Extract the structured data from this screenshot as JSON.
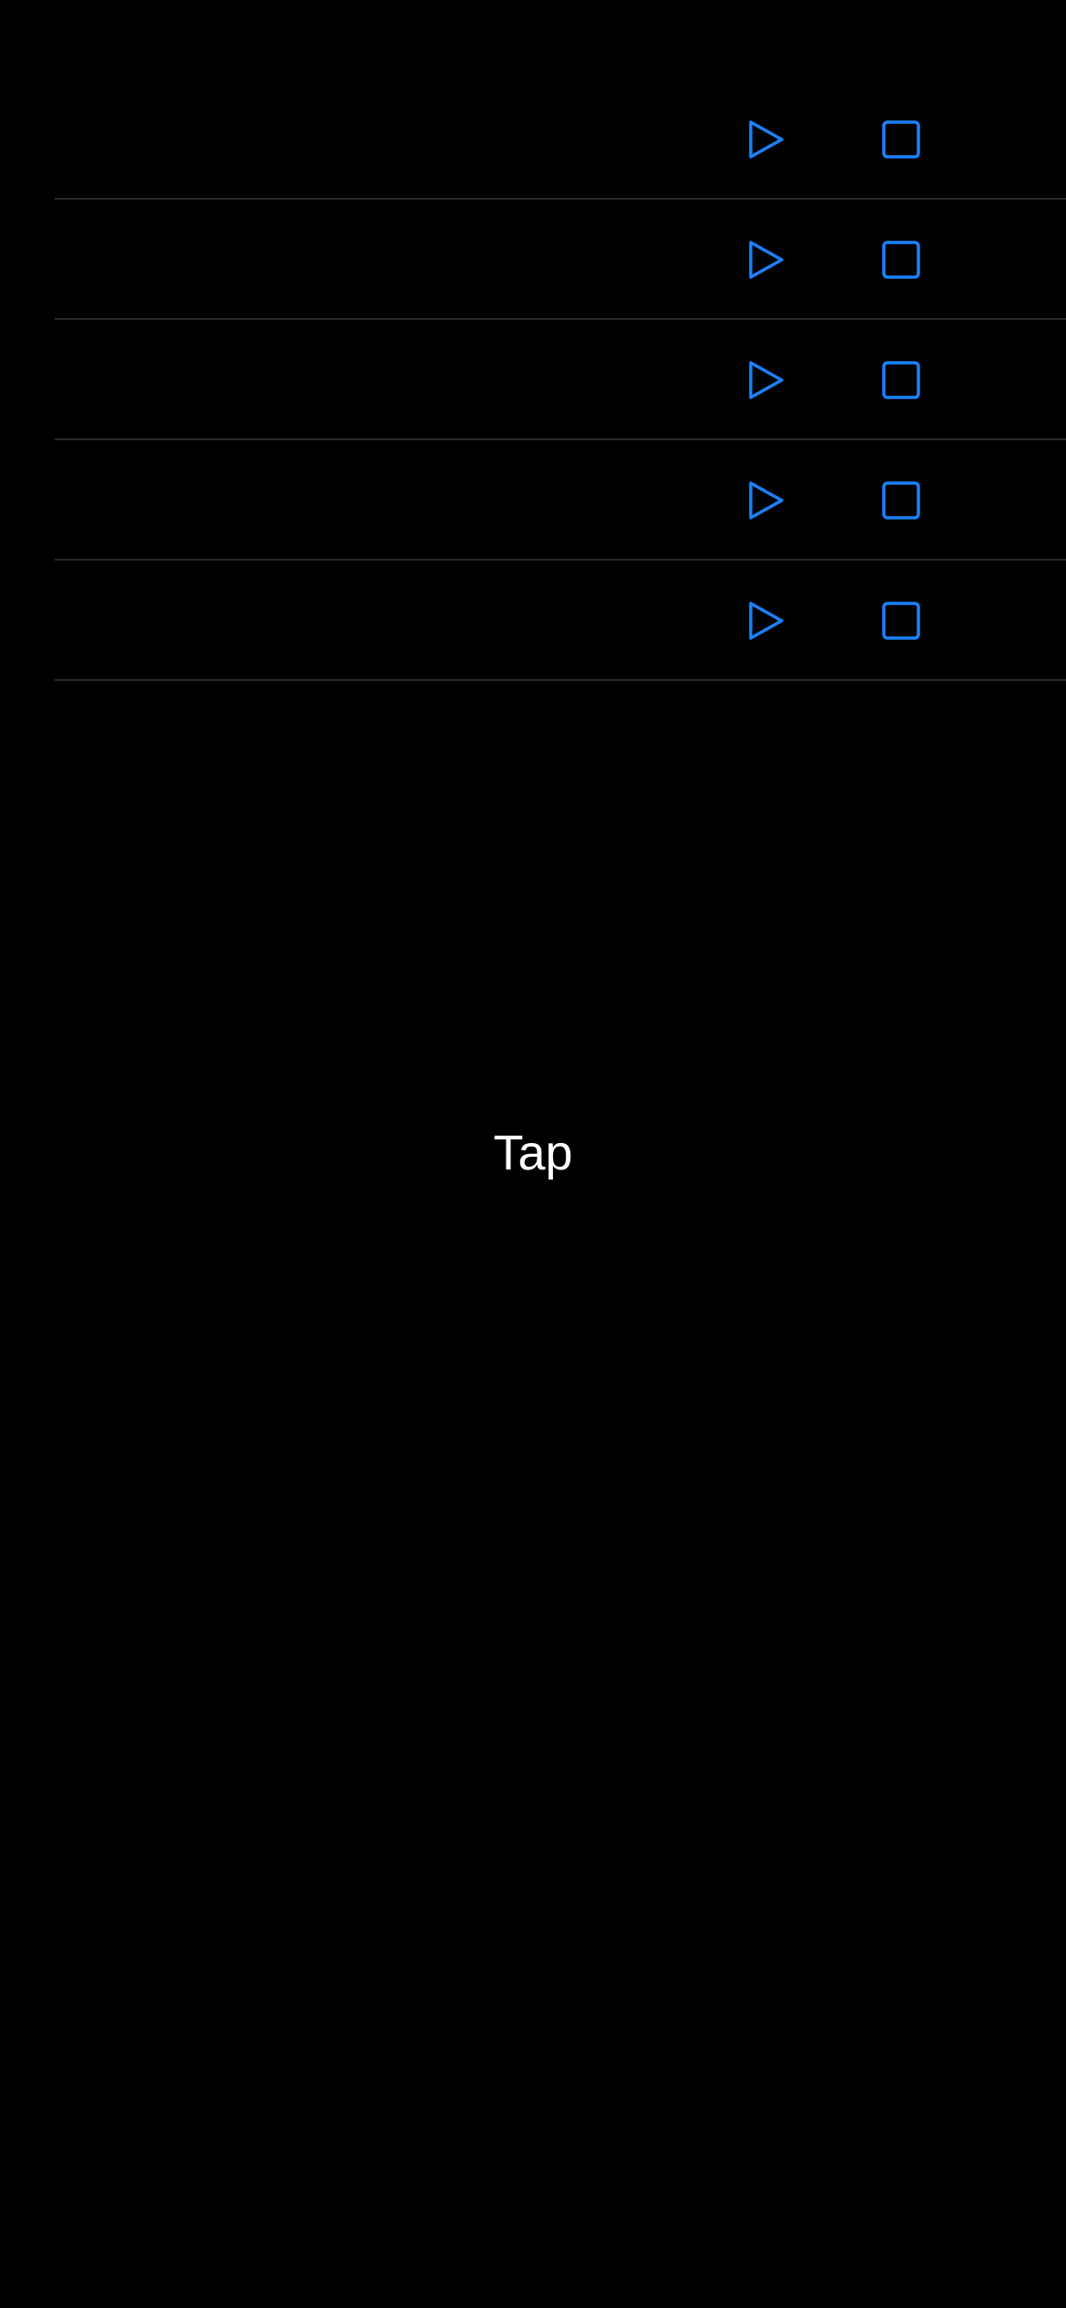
{
  "colors": {
    "background": "#000000",
    "accent": "#1A82FB",
    "divider": "#2A2A2C",
    "text": "#FFFFFF"
  },
  "rows": [
    {
      "play_icon": "play-icon",
      "stop_icon": "stop-icon"
    },
    {
      "play_icon": "play-icon",
      "stop_icon": "stop-icon"
    },
    {
      "play_icon": "play-icon",
      "stop_icon": "stop-icon"
    },
    {
      "play_icon": "play-icon",
      "stop_icon": "stop-icon"
    },
    {
      "play_icon": "play-icon",
      "stop_icon": "stop-icon"
    }
  ],
  "tap_label": "Tap"
}
